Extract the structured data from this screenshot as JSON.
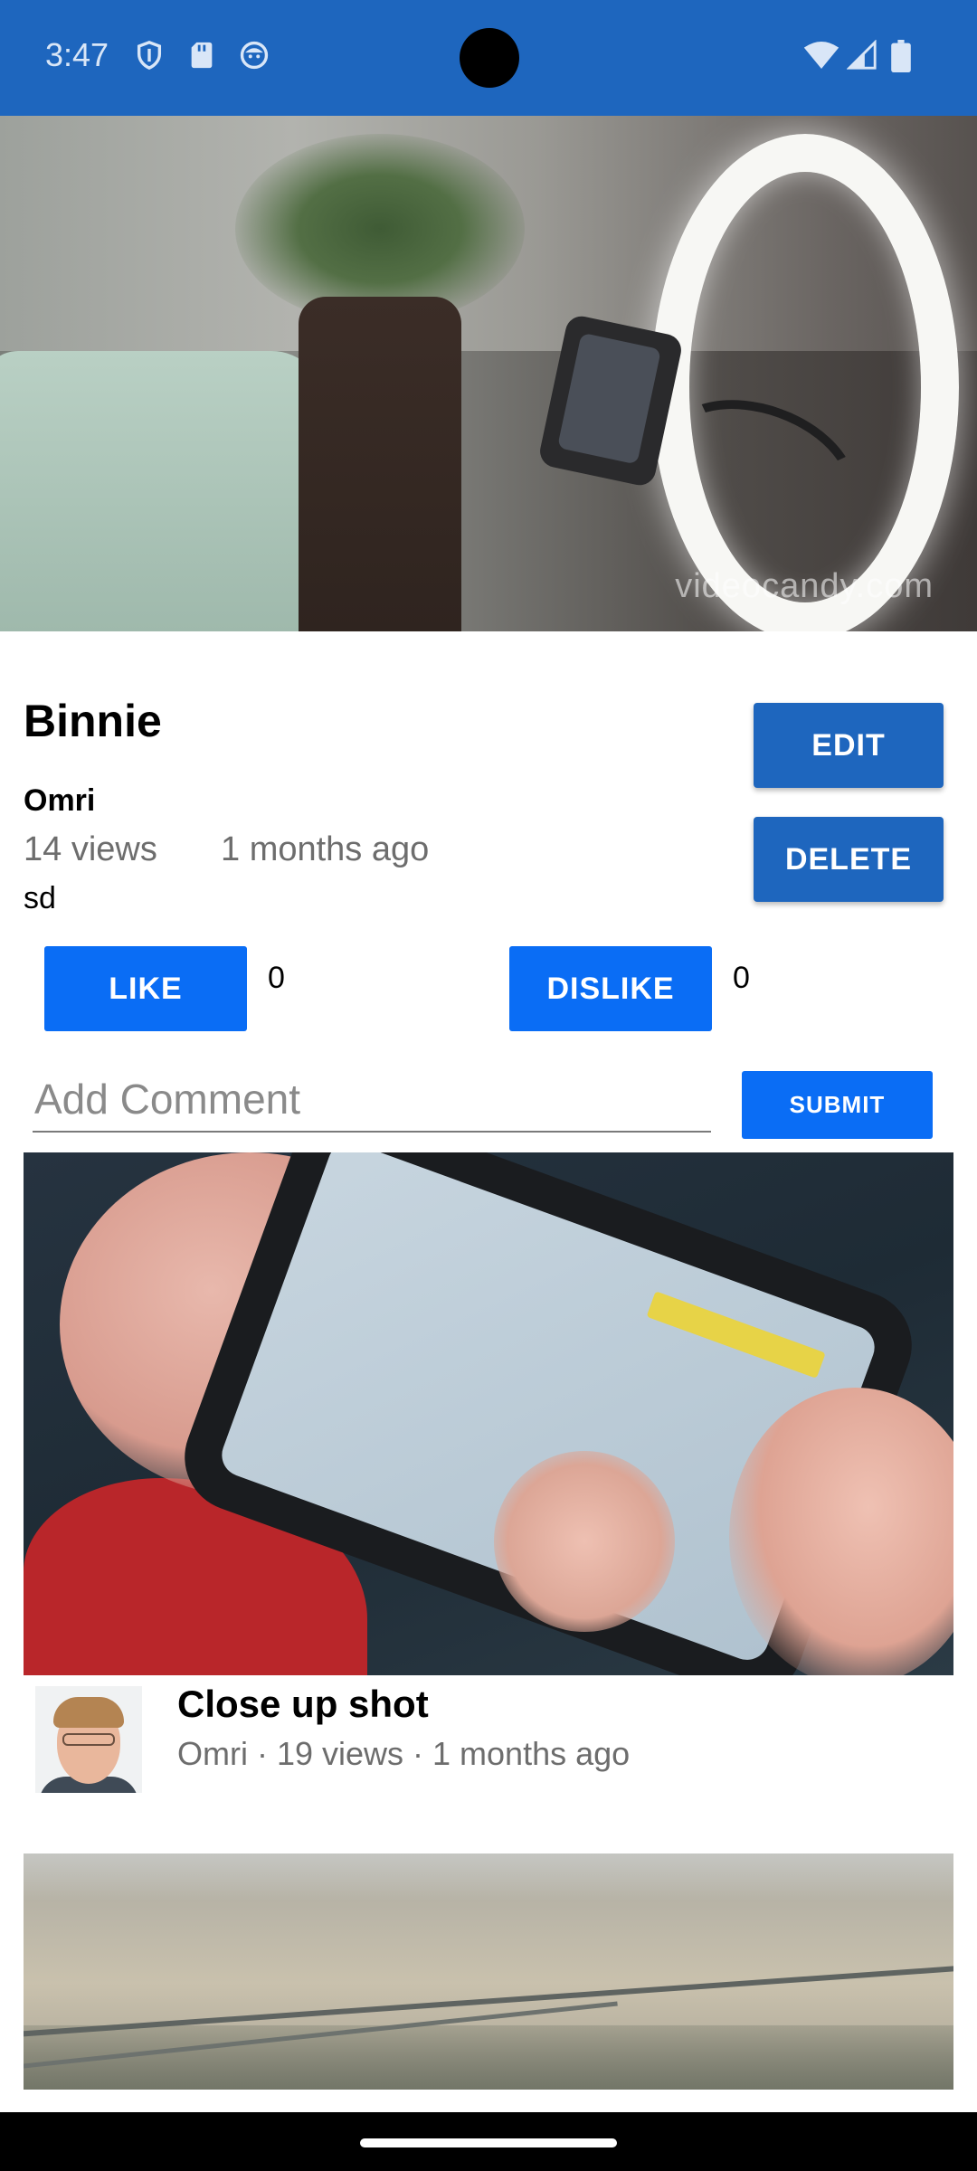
{
  "status_bar": {
    "time": "3:47",
    "left_icons": [
      "shield-icon",
      "sd-card-icon",
      "face-icon"
    ],
    "right_icons": [
      "wifi-icon",
      "cell-signal-icon",
      "battery-icon"
    ],
    "color": "#1e66be"
  },
  "hero": {
    "watermark": "videocandy.com"
  },
  "video": {
    "title": "Binnie",
    "author": "Omri",
    "views": "14 views",
    "age": "1 months ago",
    "description": "sd"
  },
  "actions": {
    "edit_label": "EDIT",
    "delete_label": "DELETE",
    "like_label": "LIKE",
    "like_count": "0",
    "dislike_label": "DISLIKE",
    "dislike_count": "0"
  },
  "comment": {
    "placeholder": "Add Comment",
    "value": "",
    "submit_label": "SUBMIT"
  },
  "suggested": [
    {
      "title": "Close up shot",
      "meta": "Omri · 19 views · 1 months ago"
    }
  ],
  "colors": {
    "primary_dark": "#1e66be",
    "primary_bright": "#0a6df5",
    "secondary_text": "#6d6d6d"
  }
}
